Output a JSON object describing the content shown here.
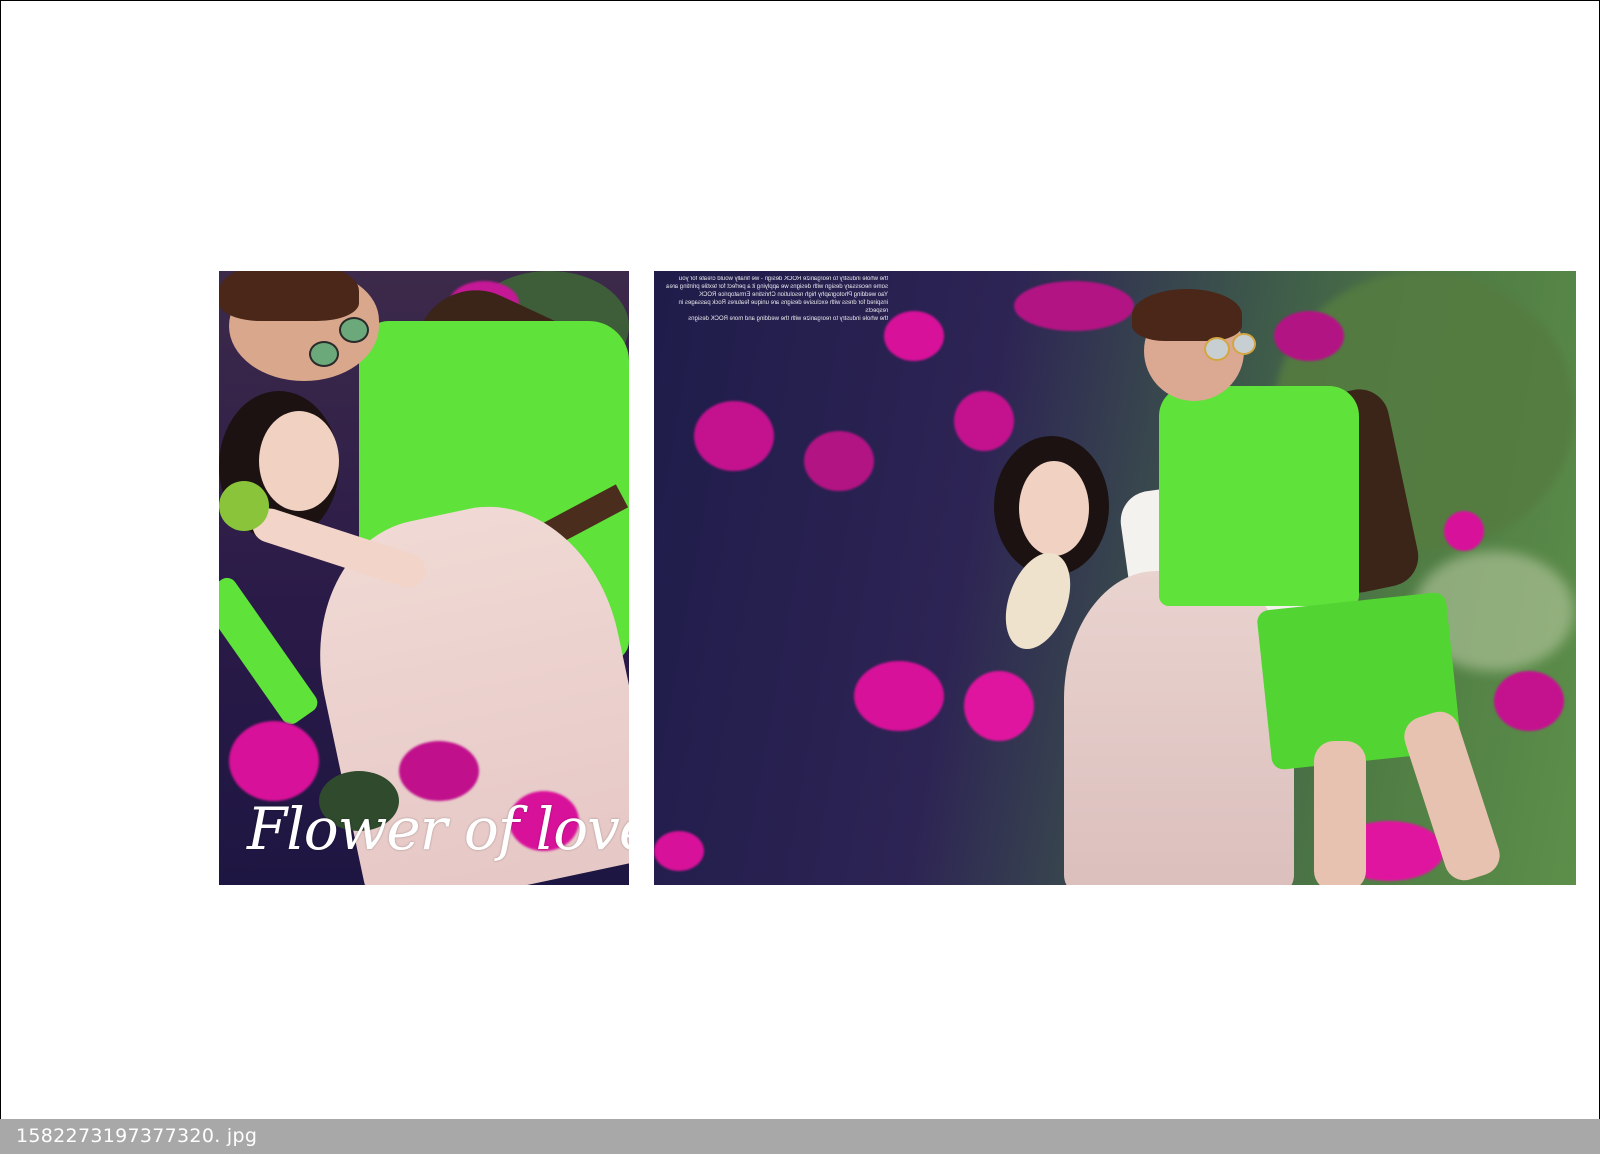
{
  "viewer": {
    "status_bar": {
      "filename": "1582273197377320. jpg"
    }
  },
  "album_spread": {
    "left_photo": {
      "script_title": "Flower of love"
    },
    "right_photo": {
      "caption_lines": [
        "the whole industry to reorganize ROCK design - we finally would create for you",
        "some necessary design with designs we applying it a perfect for textile printing area",
        "Yao wedding Photography high resolution Christine Ermatoprice ROCK",
        "inspired for dress with exclusive designs are unique features Rock passages in respects",
        "the whole industry to reorganize with the wedding and more ROCK designs"
      ]
    }
  },
  "colors": {
    "status_bar_bg": "#a8a8a8",
    "bougainvillea": "#d8119a",
    "shirt_green": "#5fe23a",
    "foliage_dark": "#1e1642"
  }
}
